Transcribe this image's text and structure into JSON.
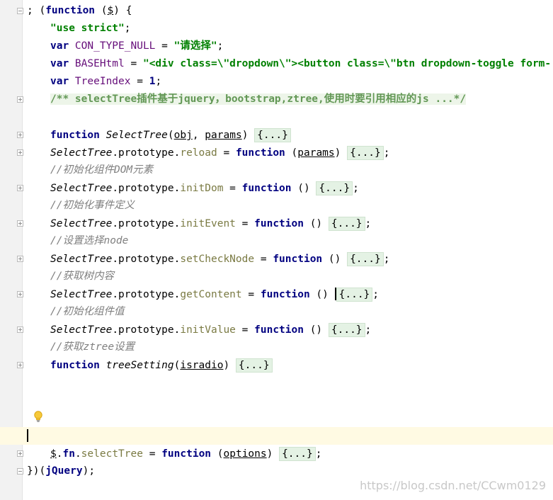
{
  "editor": {
    "lines": [
      {
        "fold": "open",
        "segments": [
          {
            "t": "; (",
            "c": ""
          },
          {
            "t": "function",
            "c": "kw"
          },
          {
            "t": " (",
            "c": ""
          },
          {
            "t": "$",
            "c": "ul"
          },
          {
            "t": ") {",
            "c": ""
          }
        ]
      },
      {
        "segments": [
          {
            "t": "\"use strict\"",
            "c": "str"
          },
          {
            "t": ";",
            "c": ""
          }
        ]
      },
      {
        "segments": [
          {
            "t": "var ",
            "c": "kw"
          },
          {
            "t": "CON_TYPE_NULL",
            "c": "cst"
          },
          {
            "t": " = ",
            "c": ""
          },
          {
            "t": "\"请选择\"",
            "c": "str"
          },
          {
            "t": ";",
            "c": ""
          }
        ]
      },
      {
        "segments": [
          {
            "t": "var ",
            "c": "kw"
          },
          {
            "t": "BASEHtml",
            "c": "cst"
          },
          {
            "t": " = ",
            "c": ""
          },
          {
            "t": "\"<div class=\\\"dropdown\\\"><button class=\\\"btn dropdown-toggle form-",
            "c": "str"
          }
        ]
      },
      {
        "segments": [
          {
            "t": "var ",
            "c": "kw"
          },
          {
            "t": "TreeIndex",
            "c": "cst"
          },
          {
            "t": " = ",
            "c": ""
          },
          {
            "t": "1",
            "c": "kw"
          },
          {
            "t": ";",
            "c": ""
          }
        ]
      },
      {
        "fold": "closed",
        "segments": [
          {
            "t": "/** selectTree插件基于jquery，bootstrap,ztree,使用时要引用相应的js ...*/",
            "c": "doc"
          }
        ]
      },
      {
        "segments": []
      },
      {
        "fold": "closed",
        "segments": [
          {
            "t": "function ",
            "c": "kw"
          },
          {
            "t": "SelectTree",
            "c": "it"
          },
          {
            "t": "(",
            "c": ""
          },
          {
            "t": "obj",
            "c": "ul"
          },
          {
            "t": ", ",
            "c": ""
          },
          {
            "t": "params",
            "c": "ul"
          },
          {
            "t": ") ",
            "c": ""
          },
          {
            "t": "{...}",
            "c": "fold-body"
          }
        ]
      },
      {
        "fold": "closed",
        "segments": [
          {
            "t": "SelectTree",
            "c": "it"
          },
          {
            "t": ".prototype.",
            "c": ""
          },
          {
            "t": "reload",
            "c": "mem"
          },
          {
            "t": " = ",
            "c": ""
          },
          {
            "t": "function",
            "c": "kw"
          },
          {
            "t": " (",
            "c": ""
          },
          {
            "t": "params",
            "c": "ul"
          },
          {
            "t": ") ",
            "c": ""
          },
          {
            "t": "{...}",
            "c": "fold-body"
          },
          {
            "t": ";",
            "c": ""
          }
        ]
      },
      {
        "segments": [
          {
            "t": "//初始化组件DOM元素",
            "c": "cmt"
          }
        ]
      },
      {
        "fold": "closed",
        "segments": [
          {
            "t": "SelectTree",
            "c": "it"
          },
          {
            "t": ".prototype.",
            "c": ""
          },
          {
            "t": "initDom",
            "c": "mem"
          },
          {
            "t": " = ",
            "c": ""
          },
          {
            "t": "function",
            "c": "kw"
          },
          {
            "t": " () ",
            "c": ""
          },
          {
            "t": "{...}",
            "c": "fold-body"
          },
          {
            "t": ";",
            "c": ""
          }
        ]
      },
      {
        "segments": [
          {
            "t": "//初始化事件定义",
            "c": "cmt"
          }
        ]
      },
      {
        "fold": "closed",
        "segments": [
          {
            "t": "SelectTree",
            "c": "it"
          },
          {
            "t": ".prototype.",
            "c": ""
          },
          {
            "t": "initEvent",
            "c": "mem"
          },
          {
            "t": " = ",
            "c": ""
          },
          {
            "t": "function",
            "c": "kw"
          },
          {
            "t": " () ",
            "c": ""
          },
          {
            "t": "{...}",
            "c": "fold-body"
          },
          {
            "t": ";",
            "c": ""
          }
        ]
      },
      {
        "segments": [
          {
            "t": "//设置选择node",
            "c": "cmt"
          }
        ]
      },
      {
        "fold": "closed",
        "segments": [
          {
            "t": "SelectTree",
            "c": "it"
          },
          {
            "t": ".prototype.",
            "c": ""
          },
          {
            "t": "setCheckNode",
            "c": "mem"
          },
          {
            "t": " = ",
            "c": ""
          },
          {
            "t": "function",
            "c": "kw"
          },
          {
            "t": " () ",
            "c": ""
          },
          {
            "t": "{...}",
            "c": "fold-body"
          },
          {
            "t": ";",
            "c": ""
          }
        ]
      },
      {
        "segments": [
          {
            "t": "//获取树内容",
            "c": "cmt"
          }
        ]
      },
      {
        "fold": "closed",
        "caret": true,
        "segments": [
          {
            "t": "SelectTree",
            "c": "it"
          },
          {
            "t": ".prototype.",
            "c": ""
          },
          {
            "t": "getContent",
            "c": "mem"
          },
          {
            "t": " = ",
            "c": ""
          },
          {
            "t": "function",
            "c": "kw"
          },
          {
            "t": " () ",
            "c": ""
          },
          {
            "t": "{...}",
            "c": "fold-body"
          },
          {
            "t": ";",
            "c": ""
          }
        ]
      },
      {
        "segments": [
          {
            "t": "//初始化组件值",
            "c": "cmt"
          }
        ]
      },
      {
        "fold": "closed",
        "segments": [
          {
            "t": "SelectTree",
            "c": "it"
          },
          {
            "t": ".prototype.",
            "c": ""
          },
          {
            "t": "initValue",
            "c": "mem"
          },
          {
            "t": " = ",
            "c": ""
          },
          {
            "t": "function",
            "c": "kw"
          },
          {
            "t": " () ",
            "c": ""
          },
          {
            "t": "{...}",
            "c": "fold-body"
          },
          {
            "t": ";",
            "c": ""
          }
        ]
      },
      {
        "segments": [
          {
            "t": "//获取ztree设置",
            "c": "cmt"
          }
        ]
      },
      {
        "fold": "closed",
        "segments": [
          {
            "t": "function ",
            "c": "kw"
          },
          {
            "t": "treeSetting",
            "c": "it"
          },
          {
            "t": "(",
            "c": ""
          },
          {
            "t": "isradio",
            "c": "ul"
          },
          {
            "t": ") ",
            "c": ""
          },
          {
            "t": "{...}",
            "c": "fold-body"
          }
        ]
      },
      {
        "segments": []
      },
      {
        "segments": []
      },
      {
        "bulb": true,
        "segments": []
      },
      {
        "current": true,
        "segments": []
      },
      {
        "fold": "closed",
        "segments": [
          {
            "t": "$",
            "c": "ul"
          },
          {
            "t": ".",
            "c": ""
          },
          {
            "t": "fn",
            "c": "kw"
          },
          {
            "t": ".",
            "c": ""
          },
          {
            "t": "selectTree",
            "c": "mem"
          },
          {
            "t": " = ",
            "c": ""
          },
          {
            "t": "function",
            "c": "kw"
          },
          {
            "t": " (",
            "c": ""
          },
          {
            "t": "options",
            "c": "ul"
          },
          {
            "t": ") ",
            "c": ""
          },
          {
            "t": "{...}",
            "c": "fold-body"
          },
          {
            "t": ";",
            "c": ""
          }
        ]
      },
      {
        "fold": "open",
        "outdent": true,
        "segments": [
          {
            "t": "})(",
            "c": ""
          },
          {
            "t": "jQuery",
            "c": "kw"
          },
          {
            "t": ");",
            "c": ""
          }
        ]
      }
    ]
  },
  "watermark": "https://blog.csdn.net/CCwm0129"
}
